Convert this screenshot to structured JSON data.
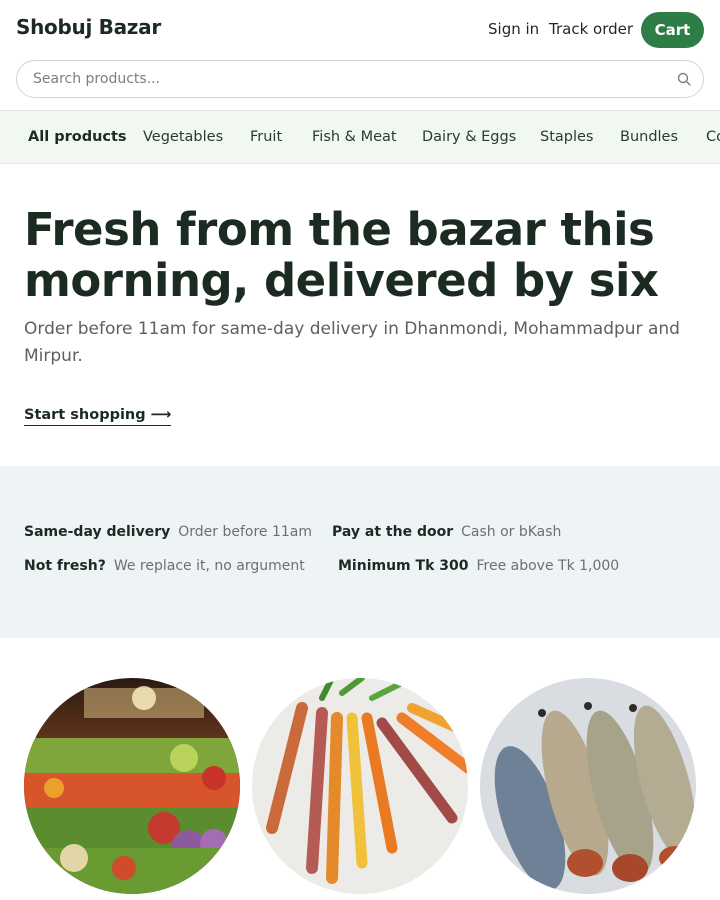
{
  "brand": {
    "name": "Shobuj Bazar"
  },
  "header": {
    "sign_in": "Sign in",
    "track_order": "Track order",
    "cart": "Cart"
  },
  "search": {
    "placeholder": "Search products...",
    "value": ""
  },
  "categories": [
    {
      "label": "All products",
      "active": true
    },
    {
      "label": "Vegetables"
    },
    {
      "label": "Fruit"
    },
    {
      "label": "Fish & Meat"
    },
    {
      "label": "Dairy & Eggs"
    },
    {
      "label": "Staples"
    },
    {
      "label": "Bundles"
    },
    {
      "label": "Co"
    }
  ],
  "hero": {
    "title": "Fresh from the bazar this morning, delivered by six",
    "subtitle": "Order before 11am for same-day delivery in Dhanmondi, Mohammadpur and Mirpur.",
    "cta": "Start shopping ⟶"
  },
  "features": [
    {
      "title": "Same-day delivery",
      "detail": "Order before 11am"
    },
    {
      "title": "Pay at the door",
      "detail": "Cash or bKash"
    },
    {
      "title": "Not fresh?",
      "detail": "We replace it, no argument"
    },
    {
      "title": "Minimum Tk 300",
      "detail": "Free above Tk 1,000"
    }
  ],
  "images": [
    {
      "icon": "vegetable-market-photo"
    },
    {
      "icon": "carrots-photo"
    },
    {
      "icon": "fish-photo"
    }
  ],
  "colors": {
    "accent": "#2e7d46",
    "category_bar_bg": "#f1f8f1",
    "info_band_bg": "#eef3f6",
    "heading": "#1c2b22"
  }
}
